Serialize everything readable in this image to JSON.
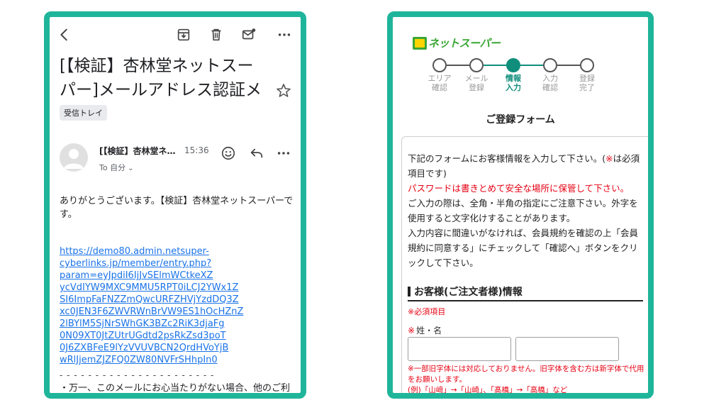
{
  "mail": {
    "subject": "[【検証】杏林堂ネットスーパー]メールアドレス認証メール",
    "label": "受信トレイ",
    "sender": "[【検証】杏林堂ネ…",
    "time": "15:36",
    "to": "To 自分",
    "greeting": "ありがとうございます。【検証】杏林堂ネットスーパーです。",
    "link_lines": [
      "https://demo80.admin.netsuper-",
      "cyberlinks.jp/member/entry.php?",
      "param=eyJpdiI6IjJvSElmWCtkeXZ",
      "ycVdIYW9MXC9MMU5RPT0iLCJ2YWx1Z",
      "SI6ImpFaFNZZmQwcURFZHVjYzdDQ3Z",
      "xc0JEN3F6ZWVRWnBrVW9ES1hOcHZnZ",
      "2lBYlM5SjNrSWhGK3BZc2RiK3djaFg",
      "0N09XT0JtZUtrUGdtd2psRkZsd3poT",
      "0J6ZXBFeE9lYzVVUVBCN2QrdHVoYjB",
      "wRlJjemZJZFQ0ZW80NVFrSHhpIn0"
    ],
    "dashes": "- - - - - - - - - - - - - - - - - - - - - -",
    "notice": "・万一、このメールにお心当たりがない場合、他のご利用者がメールアドレスを間違えて入力されたものと考え"
  },
  "signup": {
    "logo_text": "ネットスーパー",
    "steps": [
      {
        "label": "エリア\n確認",
        "active": false
      },
      {
        "label": "メール\n登録",
        "active": false
      },
      {
        "label": "情報\n入力",
        "active": true
      },
      {
        "label": "入力\n確認",
        "active": false
      },
      {
        "label": "登録\n完了",
        "active": false
      }
    ],
    "form_title": "ご登録フォーム",
    "intro_1": "下記のフォームにお客様情報を入力して下さい。(",
    "intro_mark": "※",
    "intro_2": "は必須項目です)",
    "password_note": "パスワードは書きとめて安全な場所に保管して下さい。",
    "intro_3": "ご入力の際は、全角・半角の指定にご注意下さい。外字を使用すると文字化けすることがあります。",
    "intro_4": "入力内容に間違いがなければ、会員規約を確認の上「会員規約に同意する」にチェックして「確認へ」ボタンをクリックして下さい。",
    "section_title": "お客様(ご注文者様)情報",
    "required_note": "※必須項目",
    "name_label_mark": "※",
    "name_label": "姓・名",
    "last_name_value": "",
    "first_name_value": "",
    "warning_1": "※一部旧字体には対応しておりません。旧字体を含む方は新字体で代用をお願いします。",
    "warning_2": "(例)「山﨑」→「山崎」、「髙橋」→「高橋」など"
  },
  "colors": {
    "frame": "#1fb59a",
    "step_active": "#0f8e7c",
    "required_red": "#e60012",
    "link": "#1a73e8",
    "logo_green": "#3aa635"
  }
}
